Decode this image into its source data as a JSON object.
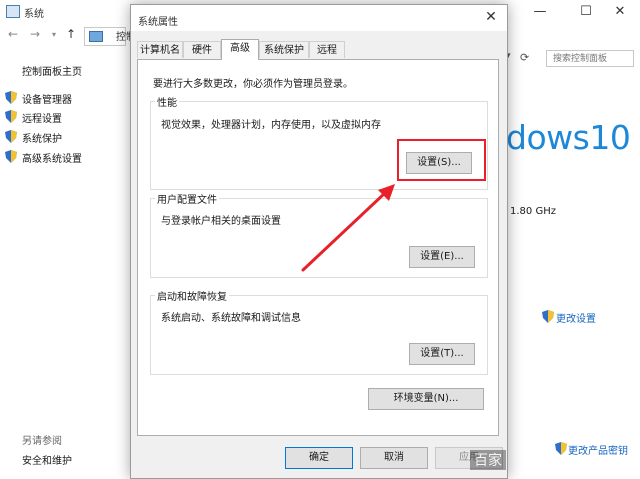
{
  "background": {
    "window_title": "系统",
    "address_text": "控制",
    "search_placeholder": "搜索控制面板",
    "sidebar": {
      "home": "控制面板主页",
      "links": [
        "设备管理器",
        "远程设置",
        "系统保护",
        "高级系统设置"
      ],
      "see_also": "另请参阅",
      "security": "安全和维护"
    },
    "edition_text": "dows10",
    "cpu_speed": "1.80 GHz",
    "change_settings": "更改设置",
    "change_product_key": "更改产品密钥",
    "watermark": "百家"
  },
  "dialog": {
    "title": "系统属性",
    "tabs": [
      "计算机名",
      "硬件",
      "高级",
      "系统保护",
      "远程"
    ],
    "active_tab": "高级",
    "notice": "要进行大多数更改，你必须作为管理员登录。",
    "performance": {
      "title": "性能",
      "desc": "视觉效果，处理器计划，内存使用，以及虚拟内存",
      "button": "设置(S)..."
    },
    "profile": {
      "title": "用户配置文件",
      "desc": "与登录帐户相关的桌面设置",
      "button": "设置(E)..."
    },
    "startup": {
      "title": "启动和故障恢复",
      "desc": "系统启动、系统故障和调试信息",
      "button": "设置(T)..."
    },
    "env_button": "环境变量(N)...",
    "ok": "确定",
    "cancel": "取消",
    "apply": "应用"
  },
  "colors": {
    "highlight": "#e8202a",
    "accent": "#0078d7",
    "link": "#1565c0"
  }
}
